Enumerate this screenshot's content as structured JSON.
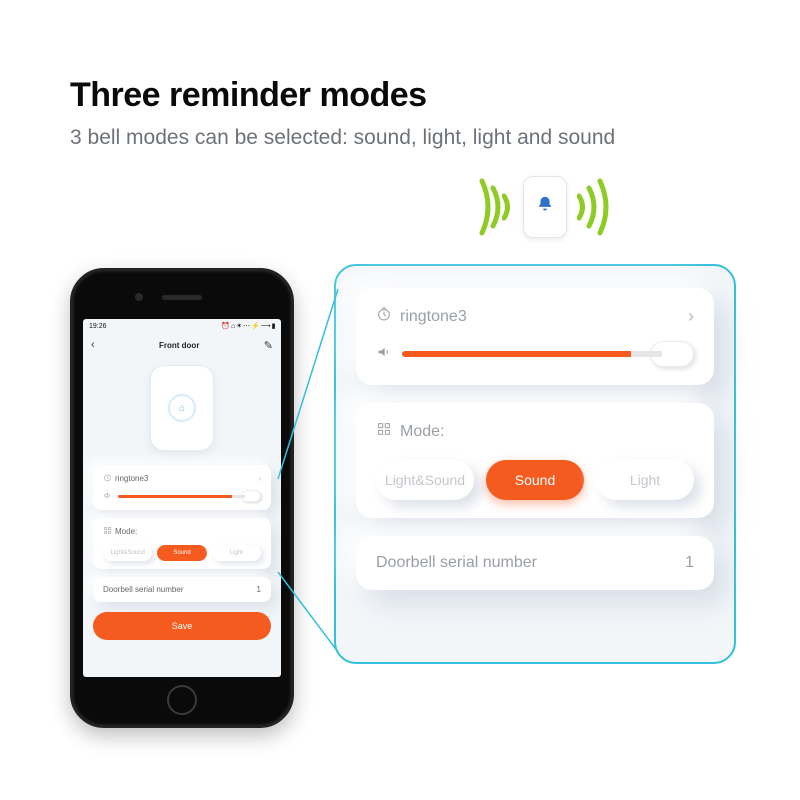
{
  "heading": "Three reminder modes",
  "subheading": "3 bell modes can be selected: sound, light, light and sound",
  "colors": {
    "accent": "#f55a1f",
    "panel_border": "#32c0de",
    "wave_green": "#8ecb24",
    "bell_blue": "#2f70c9"
  },
  "phone": {
    "status_time": "19:26",
    "status_icons": "⏰ ⌂ ✶ ⋯  ⚡ ⟶ ▮",
    "title": "Front door",
    "ringtone": {
      "label": "ringtone3",
      "volume_pct": 90
    },
    "mode": {
      "label": "Mode:",
      "options": [
        "Light&Sound",
        "Sound",
        "Light"
      ],
      "active_index": 1
    },
    "serial": {
      "label": "Doorbell serial number",
      "value": "1"
    },
    "save_label": "Save"
  },
  "panel": {
    "ringtone": {
      "label": "ringtone3",
      "volume_pct": 88
    },
    "mode": {
      "label": "Mode:",
      "options": [
        "Light&Sound",
        "Sound",
        "Light"
      ],
      "active_index": 1
    },
    "serial": {
      "label": "Doorbell serial number",
      "value": "1"
    }
  }
}
